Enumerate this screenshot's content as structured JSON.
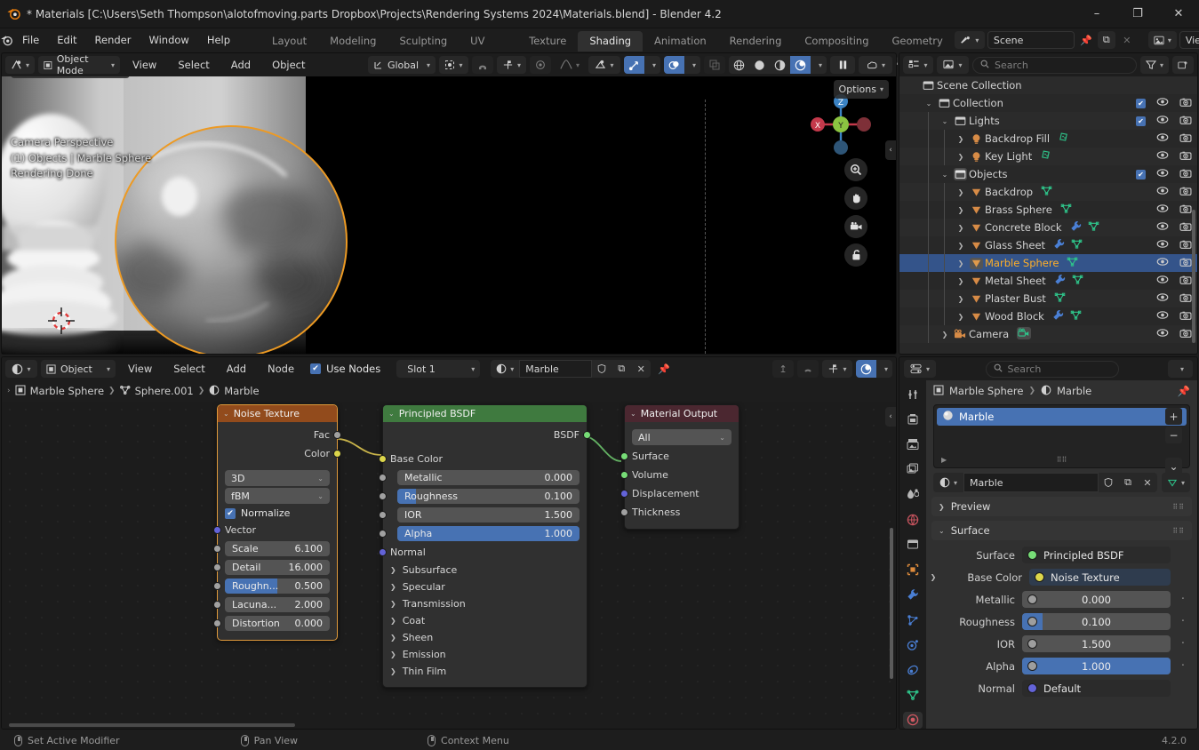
{
  "window": {
    "title": "* Materials [C:\\Users\\Seth Thompson\\alotofmoving.parts Dropbox\\Projects\\Rendering Systems 2024\\Materials.blend] - Blender 4.2",
    "minimize": "–",
    "maximize": "❐",
    "close": "✕"
  },
  "topbar": {
    "menus": [
      "File",
      "Edit",
      "Render",
      "Window",
      "Help"
    ],
    "workspaces": [
      {
        "label": "Layout",
        "active": false
      },
      {
        "label": "Modeling",
        "active": false
      },
      {
        "label": "Sculpting",
        "active": false
      },
      {
        "label": "UV Editing",
        "active": false
      },
      {
        "label": "Texture Paint",
        "active": false
      },
      {
        "label": "Shading",
        "active": true
      },
      {
        "label": "Animation",
        "active": false
      },
      {
        "label": "Rendering",
        "active": false
      },
      {
        "label": "Compositing",
        "active": false
      },
      {
        "label": "Geometry N",
        "active": false
      }
    ],
    "scene_name": "Scene",
    "viewlayer_name": "ViewLayer"
  },
  "viewport": {
    "mode": "Object Mode",
    "menus": [
      "View",
      "Select",
      "Add",
      "Object"
    ],
    "transform_orientation": "Global",
    "options_label": "Options",
    "overlay_text": [
      "Camera Perspective",
      "(1) Objects | Marble Sphere",
      "Rendering Done"
    ],
    "gizmo_axes": {
      "x": "X",
      "y": "Y",
      "z": "Z"
    }
  },
  "shader_editor": {
    "context": "Object",
    "menus": [
      "View",
      "Select",
      "Add",
      "Node"
    ],
    "use_nodes_label": "Use Nodes",
    "use_nodes_checked": true,
    "slot": "Slot 1",
    "material_name": "Marble",
    "breadcrumb": [
      "Marble Sphere",
      "Sphere.001",
      "Marble"
    ]
  },
  "nodes": {
    "noise_texture": {
      "title": "Noise Texture",
      "header_color": "#924b1c",
      "outputs": [
        {
          "name": "Fac",
          "color": "#a1a1a1"
        },
        {
          "name": "Color",
          "color": "#dcd64b"
        }
      ],
      "dimensions": "3D",
      "noise_type": "fBM",
      "normalize_label": "Normalize",
      "normalize_checked": true,
      "vector_label": "Vector",
      "properties": [
        {
          "name": "Scale",
          "value": "6.100",
          "fill": 0
        },
        {
          "name": "Detail",
          "value": "16.000",
          "fill": 0
        },
        {
          "name": "Roughn...",
          "value": "0.500",
          "fill": 50
        },
        {
          "name": "Lacuna...",
          "value": "2.000",
          "fill": 0
        },
        {
          "name": "Distortion",
          "value": "0.000",
          "fill": 0
        }
      ]
    },
    "principled_bsdf": {
      "title": "Principled BSDF",
      "header_color": "#3f7a3f",
      "output": {
        "name": "BSDF",
        "color": "#77dd77"
      },
      "base_color_label": "Base Color",
      "sliders": [
        {
          "name": "Metallic",
          "value": "0.000",
          "fill": 0
        },
        {
          "name": "Roughness",
          "value": "0.100",
          "fill": 10
        },
        {
          "name": "IOR",
          "value": "1.500",
          "fill": 0
        },
        {
          "name": "Alpha",
          "value": "1.000",
          "fill": 100
        }
      ],
      "normal_label": "Normal",
      "sections": [
        "Subsurface",
        "Specular",
        "Transmission",
        "Coat",
        "Sheen",
        "Emission",
        "Thin Film"
      ]
    },
    "material_output": {
      "title": "Material Output",
      "header_color": "#4b2730",
      "target": "All",
      "inputs": [
        {
          "name": "Surface",
          "color": "#77dd77"
        },
        {
          "name": "Volume",
          "color": "#77dd77"
        },
        {
          "name": "Displacement",
          "color": "#6363d8"
        },
        {
          "name": "Thickness",
          "color": "#a1a1a1"
        }
      ]
    }
  },
  "outliner": {
    "search_placeholder": "Search",
    "rows": [
      {
        "label": "Scene Collection",
        "indent": 0,
        "icon": "collection-icon",
        "arrow": "",
        "checkbox": false,
        "eye": false,
        "camera": false,
        "selected": false,
        "data_icons": []
      },
      {
        "label": "Collection",
        "indent": 1,
        "icon": "collection-icon",
        "arrow": "down",
        "checkbox": true,
        "eye": true,
        "camera": true,
        "selected": false,
        "data_icons": []
      },
      {
        "label": "Lights",
        "indent": 2,
        "icon": "collection-icon",
        "arrow": "down",
        "checkbox": true,
        "eye": true,
        "camera": true,
        "selected": false,
        "data_icons": []
      },
      {
        "label": "Backdrop Fill",
        "indent": 3,
        "icon": "light-icon",
        "arrow": "right",
        "checkbox": false,
        "eye": true,
        "camera": true,
        "selected": false,
        "data_icons": [
          "light-data-icon"
        ]
      },
      {
        "label": "Key Light",
        "indent": 3,
        "icon": "light-icon",
        "arrow": "right",
        "checkbox": false,
        "eye": true,
        "camera": true,
        "selected": false,
        "data_icons": [
          "light-data-icon"
        ]
      },
      {
        "label": "Objects",
        "indent": 2,
        "icon": "collection-icon-active",
        "arrow": "down",
        "checkbox": true,
        "eye": true,
        "camera": true,
        "selected": false,
        "data_icons": []
      },
      {
        "label": "Backdrop",
        "indent": 3,
        "icon": "mesh-object-icon",
        "arrow": "right",
        "checkbox": false,
        "eye": true,
        "camera": true,
        "selected": false,
        "data_icons": [
          "mesh-data-icon"
        ]
      },
      {
        "label": "Brass Sphere",
        "indent": 3,
        "icon": "mesh-object-icon",
        "arrow": "right",
        "checkbox": false,
        "eye": true,
        "camera": true,
        "selected": false,
        "data_icons": [
          "mesh-data-icon"
        ]
      },
      {
        "label": "Concrete  Block",
        "indent": 3,
        "icon": "mesh-object-icon",
        "arrow": "right",
        "checkbox": false,
        "eye": true,
        "camera": true,
        "selected": false,
        "data_icons": [
          "modifier-icon",
          "mesh-data-icon"
        ]
      },
      {
        "label": "Glass Sheet",
        "indent": 3,
        "icon": "mesh-object-icon",
        "arrow": "right",
        "checkbox": false,
        "eye": true,
        "camera": true,
        "selected": false,
        "data_icons": [
          "modifier-icon",
          "mesh-data-icon"
        ]
      },
      {
        "label": "Marble Sphere",
        "indent": 3,
        "icon": "mesh-object-icon",
        "arrow": "right",
        "checkbox": false,
        "eye": true,
        "camera": true,
        "selected": true,
        "data_icons": [
          "mesh-data-icon"
        ]
      },
      {
        "label": "Metal Sheet",
        "indent": 3,
        "icon": "mesh-object-icon",
        "arrow": "right",
        "checkbox": false,
        "eye": true,
        "camera": true,
        "selected": false,
        "data_icons": [
          "modifier-icon",
          "mesh-data-icon"
        ]
      },
      {
        "label": "Plaster Bust",
        "indent": 3,
        "icon": "mesh-object-icon",
        "arrow": "right",
        "checkbox": false,
        "eye": true,
        "camera": true,
        "selected": false,
        "data_icons": [
          "mesh-data-icon"
        ]
      },
      {
        "label": "Wood Block",
        "indent": 3,
        "icon": "mesh-object-icon",
        "arrow": "right",
        "checkbox": false,
        "eye": true,
        "camera": true,
        "selected": false,
        "data_icons": [
          "modifier-icon",
          "mesh-data-icon"
        ]
      },
      {
        "label": "Camera",
        "indent": 2,
        "icon": "camera-object-icon",
        "arrow": "right",
        "checkbox": false,
        "eye": true,
        "camera": true,
        "selected": false,
        "data_icons": [
          "camera-data-icon"
        ]
      }
    ]
  },
  "properties": {
    "search_placeholder": "Search",
    "breadcrumb": [
      "Marble Sphere",
      "Marble"
    ],
    "material_slot": "Marble",
    "material_name": "Marble",
    "add_slot": "+",
    "remove_slot": "−",
    "panels": [
      {
        "label": "Preview",
        "open": false
      },
      {
        "label": "Surface",
        "open": true
      }
    ],
    "surface_rows": [
      {
        "label": "Surface",
        "type": "link",
        "value": "Principled BSDF",
        "socket": "#77dd77"
      },
      {
        "label": "Base Color",
        "type": "linked",
        "value": "Noise Texture",
        "socket": "#dcd64b",
        "expand": true
      },
      {
        "label": "Metallic",
        "type": "slider",
        "value": "0.000",
        "fill": 0,
        "socket": "#a1a1a1"
      },
      {
        "label": "Roughness",
        "type": "slider",
        "value": "0.100",
        "fill": 10,
        "socket": "#a1a1a1"
      },
      {
        "label": "IOR",
        "type": "slider",
        "value": "1.500",
        "fill": 0,
        "socket": "#a1a1a1"
      },
      {
        "label": "Alpha",
        "type": "slider",
        "value": "1.000",
        "fill": 100,
        "socket": "#a1a1a1"
      },
      {
        "label": "Normal",
        "type": "link",
        "value": "Default",
        "socket": "#6363d8"
      }
    ]
  },
  "status": {
    "items": [
      {
        "mouse": "left",
        "label": "Set Active Modifier"
      },
      {
        "mouse": "middle",
        "label": "Pan View"
      },
      {
        "mouse": "right",
        "label": "Context Menu"
      }
    ],
    "version": "4.2.0"
  }
}
